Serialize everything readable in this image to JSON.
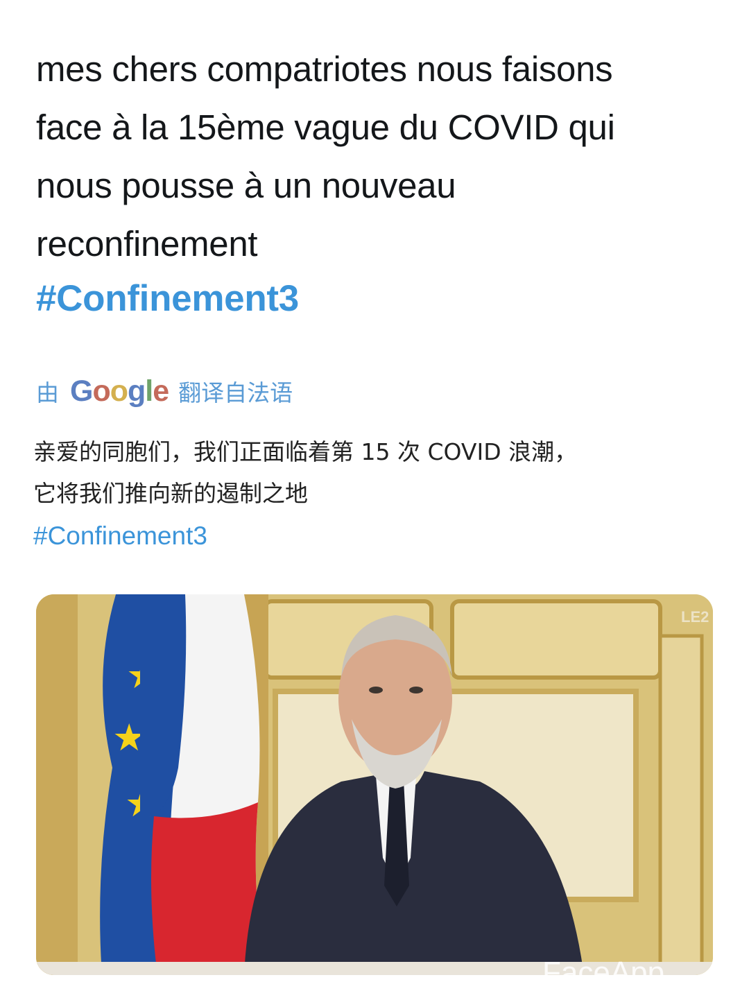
{
  "tweet": {
    "text_lines": [
      "mes chers compatriotes nous faisons",
      "face à la 15ème vague du COVID qui",
      "nous pousse à un nouveau",
      "reconfinement"
    ],
    "hashtag": "#Confinement3"
  },
  "translation_bar": {
    "prefix": "由",
    "provider_letters": [
      "G",
      "o",
      "o",
      "g",
      "l",
      "e"
    ],
    "suffix": "翻译自法语"
  },
  "translation": {
    "text_lines": [
      "亲爱的同胞们，我们正面临着第 15 次 COVID 浪潮，",
      "它将我们推向新的遏制之地"
    ],
    "hashtag": "#Confinement3"
  },
  "media": {
    "watermark_top": "LE2",
    "watermark_bottom": "FaceApp",
    "colors": {
      "wall_gold": "#d9c27a",
      "panel_cream": "#efe6c8",
      "suit": "#2a2d3e",
      "eu_blue": "#1f4fa3",
      "star": "#f5d21a",
      "fr_red": "#d8262f",
      "fr_white": "#f4f4f4"
    }
  }
}
